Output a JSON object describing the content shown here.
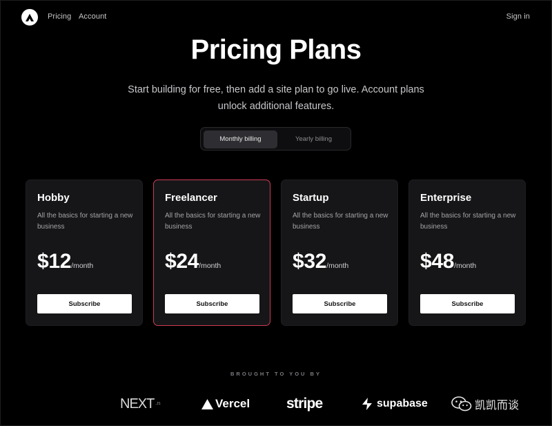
{
  "nav": {
    "links": [
      "Pricing",
      "Account"
    ],
    "sign_in": "Sign in"
  },
  "hero": {
    "title": "Pricing Plans",
    "subtitle": "Start building for free, then add a site plan to go live. Account plans unlock additional features."
  },
  "billing": {
    "options": [
      "Monthly billing",
      "Yearly billing"
    ],
    "selected": "Monthly billing"
  },
  "plans": [
    {
      "name": "Hobby",
      "description": "All the basics for starting a new business",
      "price": "$12",
      "period": "/month",
      "button": "Subscribe",
      "featured": false
    },
    {
      "name": "Freelancer",
      "description": "All the basics for starting a new business",
      "price": "$24",
      "period": "/month",
      "button": "Subscribe",
      "featured": true
    },
    {
      "name": "Startup",
      "description": "All the basics for starting a new business",
      "price": "$32",
      "period": "/month",
      "button": "Subscribe",
      "featured": false
    },
    {
      "name": "Enterprise",
      "description": "All the basics for starting a new business",
      "price": "$48",
      "period": "/month",
      "button": "Subscribe",
      "featured": false
    }
  ],
  "footer": {
    "brought_by": "BROUGHT TO YOU BY",
    "sponsors": {
      "nextjs": "NEXT",
      "nextjs_suffix": ".JS",
      "vercel": "Vercel",
      "stripe": "stripe",
      "supabase": "supabase"
    }
  },
  "watermark": {
    "text": "凯凯而谈",
    "icon": "wechat-icon"
  },
  "colors": {
    "background": "#000000",
    "card": "#161618",
    "featured_border": "#d03c57",
    "button": "#ffffff"
  }
}
